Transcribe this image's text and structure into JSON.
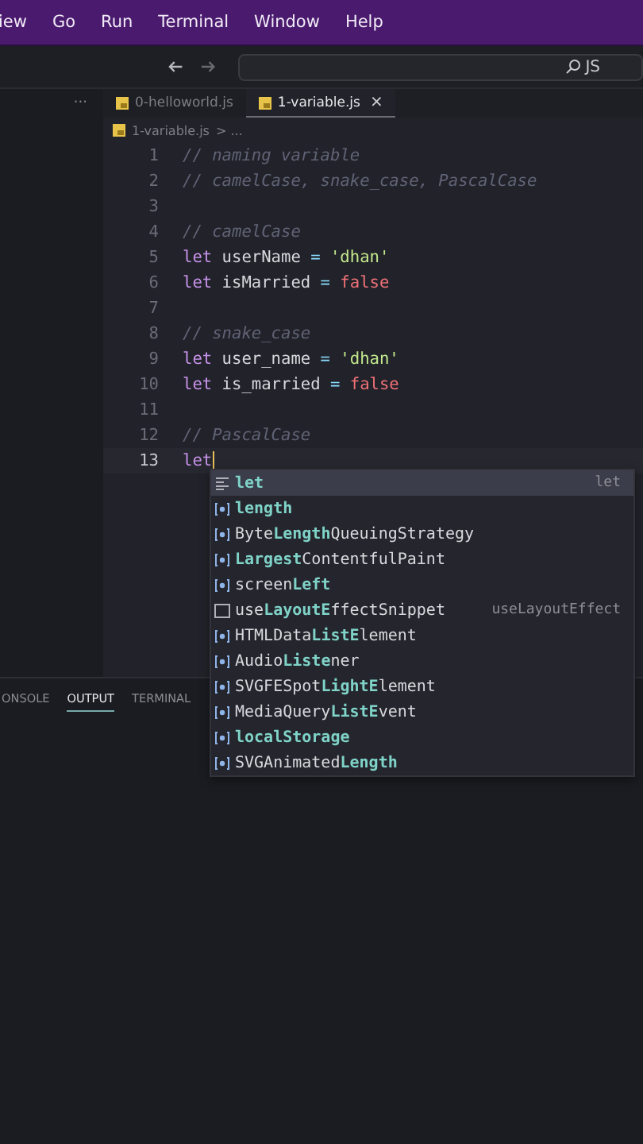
{
  "menu": [
    "iew",
    "Go",
    "Run",
    "Terminal",
    "Window",
    "Help"
  ],
  "search": {
    "value": "JS"
  },
  "sidebar": {
    "more": "···"
  },
  "tabs": [
    {
      "label": "0-helloworld.js",
      "selected": false
    },
    {
      "label": "1-variable.js",
      "selected": true,
      "close": "×"
    }
  ],
  "breadcrumb": {
    "file": "1-variable.js",
    "rest": "> ..."
  },
  "lines": [
    {
      "number": "1",
      "active": false,
      "tokens": [
        {
          "kind": "comment",
          "text": "// naming variable"
        }
      ]
    },
    {
      "number": "2",
      "active": false,
      "tokens": [
        {
          "kind": "comment",
          "text": "// camelCase, snake_case, PascalCase"
        }
      ]
    },
    {
      "number": "3",
      "active": false
    },
    {
      "number": "4",
      "active": false,
      "tokens": [
        {
          "kind": "comment",
          "text": "// camelCase"
        }
      ]
    },
    {
      "number": "5",
      "active": false,
      "tokens": [
        {
          "kind": "keyword",
          "text": "let"
        },
        {
          "kind": "ident",
          "text": "userName"
        },
        {
          "kind": "op",
          "text": "="
        },
        {
          "kind": "string",
          "text": "'dhan'"
        }
      ]
    },
    {
      "number": "6",
      "active": false,
      "tokens": [
        {
          "kind": "keyword",
          "text": "let"
        },
        {
          "kind": "ident",
          "text": "isMarried"
        },
        {
          "kind": "op",
          "text": "="
        },
        {
          "kind": "bool",
          "text": "false"
        }
      ]
    },
    {
      "number": "7",
      "active": false
    },
    {
      "number": "8",
      "active": false,
      "tokens": [
        {
          "kind": "comment",
          "text": "// snake_case"
        }
      ]
    },
    {
      "number": "9",
      "active": false,
      "tokens": [
        {
          "kind": "keyword",
          "text": "let"
        },
        {
          "kind": "ident",
          "text": "user_name"
        },
        {
          "kind": "op",
          "text": "="
        },
        {
          "kind": "string",
          "text": "'dhan'"
        }
      ]
    },
    {
      "number": "10",
      "active": false,
      "tokens": [
        {
          "kind": "keyword",
          "text": "let"
        },
        {
          "kind": "ident",
          "text": "is_married"
        },
        {
          "kind": "op",
          "text": "="
        },
        {
          "kind": "bool",
          "text": "false"
        }
      ]
    },
    {
      "number": "11",
      "active": false
    },
    {
      "number": "12",
      "active": false,
      "tokens": [
        {
          "kind": "comment",
          "text": "// PascalCase"
        }
      ]
    },
    {
      "number": "13",
      "active": true,
      "tokens": [
        {
          "kind": "keyword",
          "text": "let"
        }
      ]
    }
  ],
  "suggestions": [
    {
      "kind": "keyword",
      "label": "**let**",
      "detail": "let",
      "selected": true
    },
    {
      "kind": "variable",
      "label": "**length**",
      "selected": false
    },
    {
      "kind": "variable",
      "label": "Byte**Length**QueuingStrategy",
      "selected": false
    },
    {
      "kind": "variable",
      "label": "**Largest**ContentfulPaint",
      "selected": false
    },
    {
      "kind": "variable",
      "label": "screen**Left**",
      "selected": false
    },
    {
      "kind": "snippet",
      "label": "use**LayoutE**ffectSnippet",
      "detail": "useLayoutEffect",
      "selected": false
    },
    {
      "kind": "variable",
      "label": "HTMLData**ListE**lement",
      "selected": false
    },
    {
      "kind": "variable",
      "label": "Audio**Liste**ner",
      "selected": false
    },
    {
      "kind": "variable",
      "label": "SVGFESpot**LightE**lement",
      "selected": false
    },
    {
      "kind": "variable",
      "label": "MediaQuery**ListE**vent",
      "selected": false
    },
    {
      "kind": "variable",
      "label": "**localStorage**",
      "selected": false
    },
    {
      "kind": "variable",
      "label": "SVGAnimated**Length**",
      "selected": false
    }
  ],
  "panel_tabs": [
    {
      "label": "ONSOLE",
      "selected": false
    },
    {
      "label": "OUTPUT",
      "selected": true
    },
    {
      "label": "TERMINAL",
      "selected": false
    }
  ]
}
